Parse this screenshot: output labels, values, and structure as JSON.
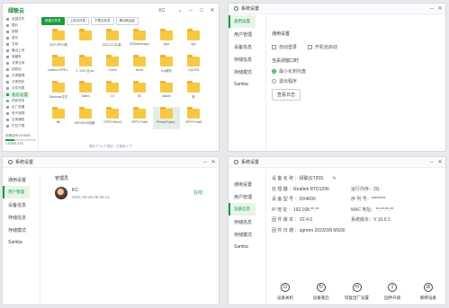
{
  "file_manager": {
    "app_name": "绿联云",
    "app_sub": "ugreen",
    "window_controls": [
      "KC",
      "⌄",
      "─",
      "□",
      "✕"
    ],
    "sidebar": [
      "全部文件",
      "图片",
      "视频",
      "音乐",
      "文档",
      "最近上传",
      "收藏夹",
      "共享空间",
      "回收站",
      "分类管理",
      "分享资料",
      "文件列表",
      "备份设置",
      "同步任务",
      "出厂设置",
      "电子读物",
      "应用通知",
      "打包下载"
    ],
    "active_item_index": 12,
    "storage_label": "存储空间 DX4600",
    "storage_value": "1.5TB/5.4TB",
    "storage_fraction": 0.28,
    "toolbar": [
      "新建文件夹",
      "上传文件夹",
      "下载文件夹",
      "移动到此处"
    ],
    "files": [
      "2022 OPPO新",
      ".",
      "2022-12-25-新..",
      "[BT]webdesign",
      "apps",
      "app",
      "Cadence SPB 1..",
      "C. 2019 全 ad..",
      "Comm",
      "drives",
      "Ezy服务",
      "LIQ2078",
      "Electronic文件",
      "Tables",
      "LX",
      "NO",
      "shared",
      "新",
      "file",
      "HIKVISION设备..",
      "OPPO Reno5",
      "OPPO Find5",
      "PhotonProject..",
      "OPPO Find8"
    ],
    "selected_file_index": 22,
    "status": "展示了 11 个项目 · 已选择 1 个"
  },
  "settings_general": {
    "title": "系统设置",
    "sidebar": [
      "通用设置",
      "用户管理",
      "设备信息",
      "存储信息",
      "存储模式",
      "Samba"
    ],
    "heading": "通用设置",
    "checkboxes": [
      "自动登录",
      "开机自启动"
    ],
    "close_heading": "当关闭窗口时",
    "radios": [
      "最小化到托盘",
      "退出程序"
    ],
    "log_button": "查看日志"
  },
  "settings_user": {
    "title": "系统设置",
    "sidebar": [
      "通用设置",
      "用户管理",
      "设备信息",
      "存储信息",
      "存储模式",
      "Samba"
    ],
    "heading": "管理员",
    "user_name": "KC",
    "user_time": "2021-06-26 09:25:14",
    "status": "在线"
  },
  "settings_device": {
    "title": "系统设置",
    "sidebar": [
      "通用设置",
      "用户管理",
      "设备信息",
      "存储信息",
      "存储模式",
      "Samba"
    ],
    "rows": [
      [
        "设 备 名 称 ：",
        "绿联云T20S",
        "",
        ""
      ],
      [
        "处 理 器 ：",
        "Realtek RTD1296",
        "运行内存：",
        "2G"
      ],
      [
        "设 备 型 号 ：",
        "DX4600",
        "序 列 号：",
        "********"
      ],
      [
        "IP 地 址 ：",
        "192.168.**.**",
        "MAC 地址：",
        "**:**:**:**"
      ],
      [
        "固 件 版 本 ：",
        "V2.4.0",
        "系统版本：",
        "V 10.0.1"
      ],
      [
        "固 件 日 期 ：",
        "ugreen 2023/3/8 MS00",
        "",
        ""
      ]
    ],
    "actions": [
      {
        "label": "设备关机",
        "icon": "power-icon"
      },
      {
        "label": "设备重启",
        "icon": "restart-icon"
      },
      {
        "label": "恢复出厂设置",
        "icon": "reset-icon"
      },
      {
        "label": "固件升级",
        "icon": "upgrade-icon"
      },
      {
        "label": "解绑设备",
        "icon": "unbind-icon"
      }
    ]
  }
}
